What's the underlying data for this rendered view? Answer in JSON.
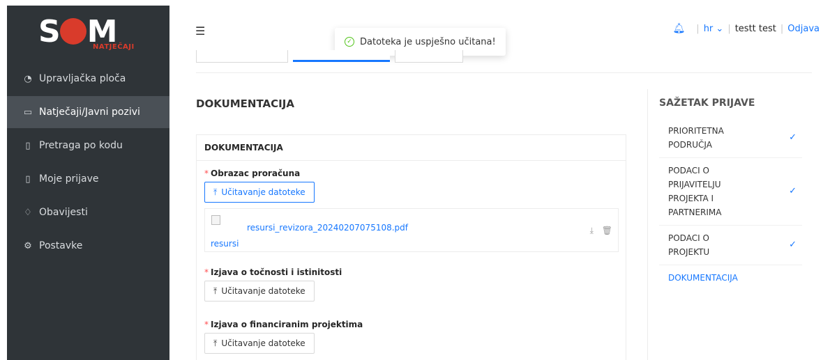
{
  "brand": {
    "logo_text": "SOM",
    "logo_sub": "NATJEČAJI"
  },
  "sidebar": {
    "items": [
      {
        "label": "Upravljačka ploča",
        "icon": "dashboard-icon"
      },
      {
        "label": "Natječaji/Javni pozivi",
        "icon": "folder-open-icon"
      },
      {
        "label": "Pretraga po kodu",
        "icon": "file-icon"
      },
      {
        "label": "Moje prijave",
        "icon": "file-check-icon"
      },
      {
        "label": "Obavijesti",
        "icon": "bell-icon"
      },
      {
        "label": "Postavke",
        "icon": "gear-icon"
      }
    ],
    "active_index": 1
  },
  "header": {
    "language": "hr",
    "user_name": "testt test",
    "logout_label": "Odjava"
  },
  "toast": {
    "message": "Datoteka je uspješno učitana!"
  },
  "main": {
    "title": "DOKUMENTACIJA",
    "card_title": "DOKUMENTACIJA",
    "fields": [
      {
        "label": "Obrazac proračuna",
        "button": "Učitavanje datoteke"
      },
      {
        "label": "Izjava o točnosti i istinitosti",
        "button": "Učitavanje datoteke"
      },
      {
        "label": "Izjava o financiranim projektima",
        "button": "Učitavanje datoteke"
      }
    ],
    "uploaded_file": {
      "name": "resursi_revizora_20240207075108.pdf",
      "alt": "resursi"
    }
  },
  "summary": {
    "title": "SAŽETAK PRIJAVE",
    "items": [
      {
        "label": "PRIORITETNA PODRUČJA",
        "done": true
      },
      {
        "label": "PODACI O PRIJAVITELJU PROJEKTA I PARTNERIMA",
        "done": true
      },
      {
        "label": "PODACI O PROJEKTU",
        "done": true
      },
      {
        "label": "DOKUMENTACIJA",
        "done": false
      }
    ]
  },
  "colors": {
    "accent": "#1677ff",
    "sidebar_bg": "#2f3438",
    "brand_red": "#d93b2b",
    "success": "#52c41a",
    "required": "#ff4d4f"
  }
}
